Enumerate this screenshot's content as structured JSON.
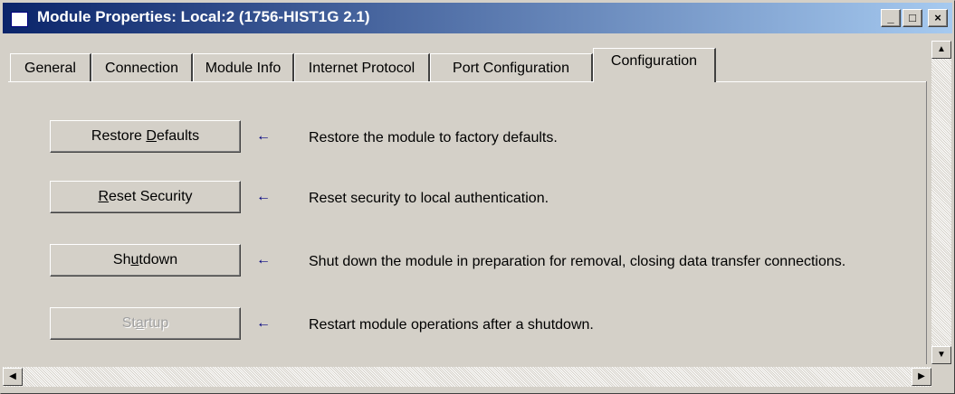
{
  "window": {
    "title": "Module Properties: Local:2 (1756-HIST1G 2.1)",
    "controls": {
      "minimize": "_",
      "maximize": "□",
      "close": "×"
    }
  },
  "tabs": [
    {
      "label": "General"
    },
    {
      "label": "Connection"
    },
    {
      "label": "Module Info"
    },
    {
      "label": "Internet Protocol"
    },
    {
      "label": "Port Configuration"
    },
    {
      "label": "Configuration",
      "active": true
    }
  ],
  "actions": [
    {
      "button": "Restore Defaults",
      "mnemonic": "D",
      "description": "Restore the module to factory defaults.",
      "enabled": true
    },
    {
      "button": "Reset Security",
      "mnemonic": "R",
      "description": "Reset security to local authentication.",
      "enabled": true
    },
    {
      "button": "Shutdown",
      "mnemonic": "u",
      "description": "Shut down the module in preparation for removal, closing data transfer connections.",
      "enabled": true
    },
    {
      "button": "Startup",
      "mnemonic": "a",
      "description": "Restart module operations after a shutdown.",
      "enabled": false
    }
  ],
  "arrow_glyph": "←",
  "colors": {
    "titlebar_start": "#0a246a",
    "titlebar_end": "#a6caf0",
    "face": "#d4d0c8",
    "arrow": "#000080"
  }
}
